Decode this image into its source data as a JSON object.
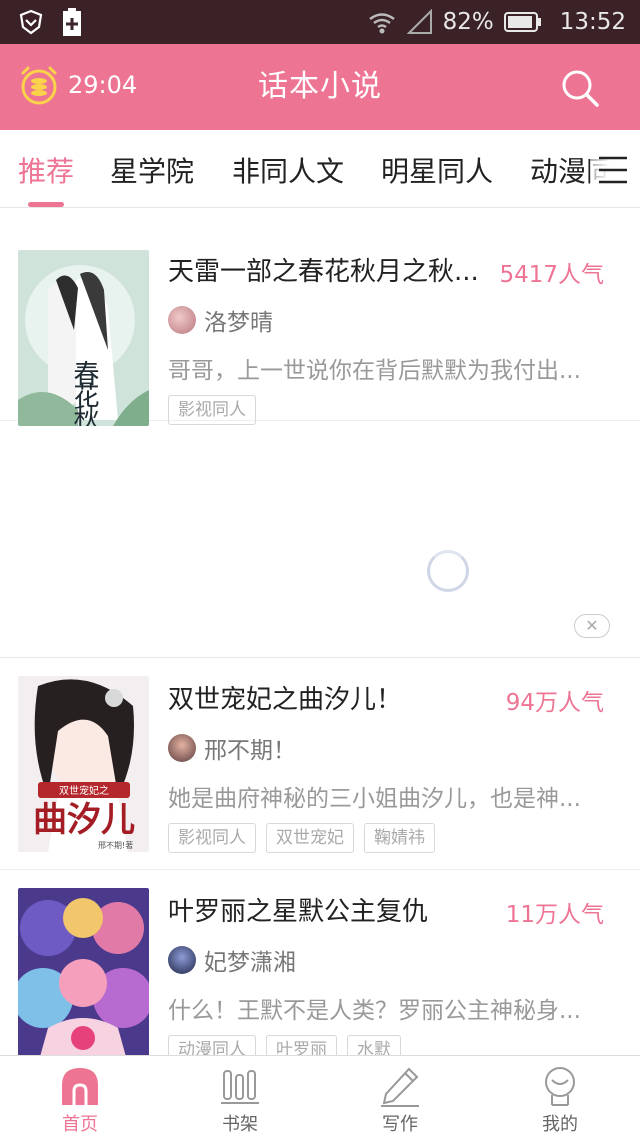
{
  "status_bar": {
    "battery_percent": "82%",
    "time": "13:52"
  },
  "app_bar": {
    "timer": "29:04",
    "title": "话本小说"
  },
  "tabs": [
    {
      "label": "推荐"
    },
    {
      "label": "星学院"
    },
    {
      "label": "非同人文"
    },
    {
      "label": "明星同人"
    },
    {
      "label": "动漫同"
    }
  ],
  "books": [
    {
      "title": "天雷一部之春花秋月之秋...",
      "popularity": "5417人气",
      "author": "洛梦晴",
      "description": "哥哥，上一世说你在背后默默为我付出...",
      "tags": [
        "影视同人"
      ],
      "cover_text": "春花秋月"
    },
    {
      "title": "双世宠妃之曲汐儿！",
      "popularity": "94万人气",
      "author": "邢不期！",
      "description": "她是曲府神秘的三小姐曲汐儿，也是神...",
      "tags": [
        "影视同人",
        "双世宠妃",
        "鞠婧祎"
      ],
      "cover_text": "曲汐儿"
    },
    {
      "title": "叶罗丽之星默公主复仇",
      "popularity": "11万人气",
      "author": "妃梦潇湘",
      "description": "什么！王默不是人类？罗丽公主神秘身...",
      "tags": [
        "动漫同人",
        "叶罗丽",
        "水默"
      ],
      "cover_text": ""
    }
  ],
  "ad": {
    "close_symbol": "✕"
  },
  "bottom_nav": [
    {
      "label": "首页"
    },
    {
      "label": "书架"
    },
    {
      "label": "写作"
    },
    {
      "label": "我的"
    }
  ],
  "colors": {
    "accent": "#ee7494",
    "status_bar": "#3b2227"
  }
}
